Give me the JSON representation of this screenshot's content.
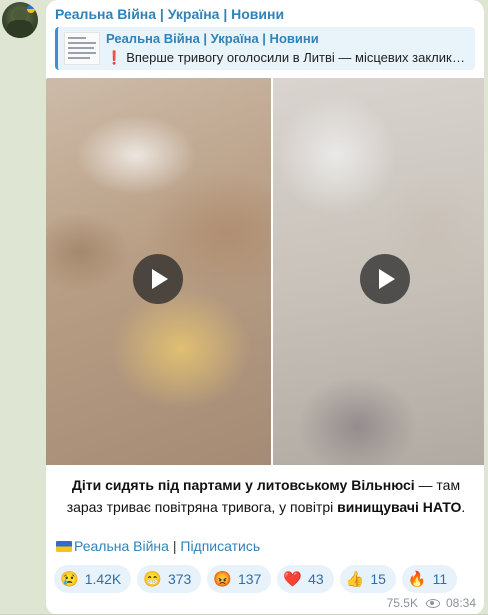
{
  "channel": {
    "title": "Реальна Війна | Україна | Новини"
  },
  "reply": {
    "title": "Реальна Війна | Україна | Новини",
    "emoji": "❗",
    "text": "Вперше тривогу оголосили в Литві — місцевих закликали пройти до укриттів"
  },
  "media": {
    "videos": [
      {
        "name": "video-left",
        "play_icon": "play-icon"
      },
      {
        "name": "video-right",
        "play_icon": "play-icon"
      }
    ]
  },
  "caption": {
    "part1": "Діти сидять під партами у литовському Вільнюсі",
    "part2": " — там зараз триває повітряна тривога, у повітрі ",
    "part3": "винищувачі НАТО",
    "part4": "."
  },
  "signature": {
    "channel_link": "Реальна Війна",
    "separator": " | ",
    "subscribe": "Підписатись"
  },
  "reactions": [
    {
      "emoji": "😢",
      "count": "1.42K"
    },
    {
      "emoji": "😁",
      "count": "373"
    },
    {
      "emoji": "😡",
      "count": "137"
    },
    {
      "emoji": "❤️",
      "count": "43"
    },
    {
      "emoji": "👍",
      "count": "15"
    },
    {
      "emoji": "🔥",
      "count": "11"
    }
  ],
  "meta": {
    "views": "75.5K",
    "time": "08:34"
  },
  "colors": {
    "background": "#dfe5d3",
    "accent": "#2f83b9",
    "reaction_bg": "#e8f2fb"
  }
}
